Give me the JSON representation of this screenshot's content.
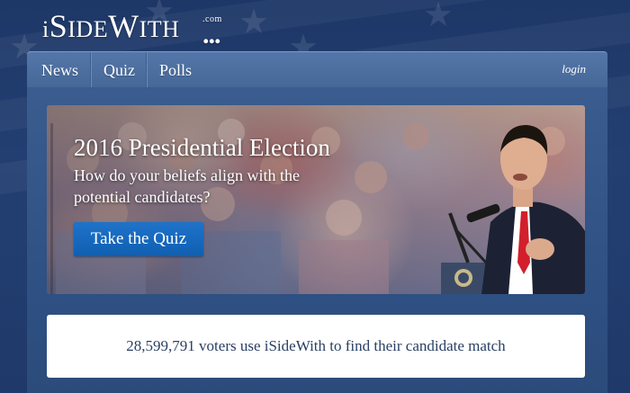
{
  "site": {
    "logo_text": "iSideWith",
    "logo_suffix": ".com",
    "logo_dots": "..."
  },
  "nav": {
    "items": [
      {
        "label": "News"
      },
      {
        "label": "Quiz"
      },
      {
        "label": "Polls"
      }
    ],
    "login_label": "login"
  },
  "hero": {
    "title": "2016 Presidential Election",
    "subtitle": "How do your beliefs align with the potential candidates?",
    "cta_label": "Take the Quiz"
  },
  "stats": {
    "voters_text": "28,599,791 voters use iSideWith to find their candidate match"
  },
  "colors": {
    "background": "#1f396a",
    "navbar": "#4c6e9f",
    "cta": "#1467bb",
    "card_text": "#2a4064"
  }
}
